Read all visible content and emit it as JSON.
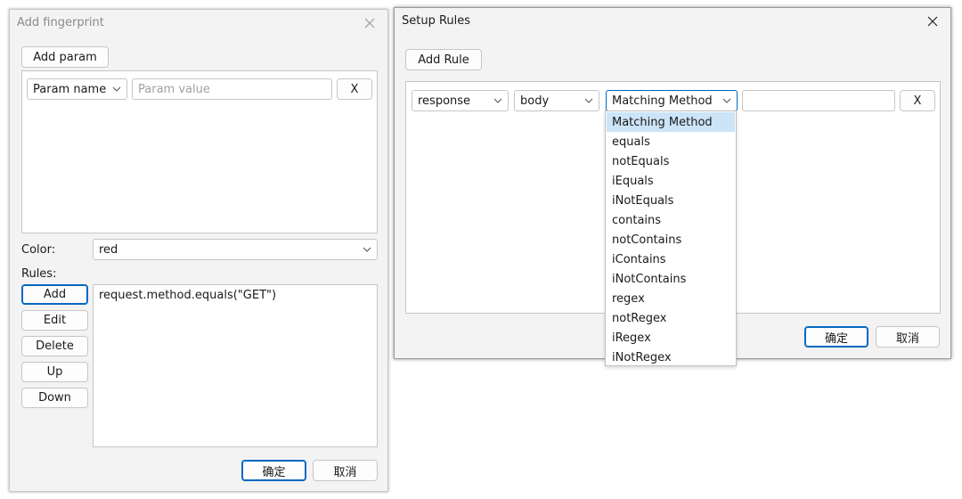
{
  "left_window": {
    "title": "Add fingerprint",
    "add_param_label": "Add param",
    "param_row": {
      "param_name": "Param name",
      "param_value_placeholder": "Param value",
      "remove_label": "X"
    },
    "color_label": "Color:",
    "color_value": "red",
    "rules_label": "Rules:",
    "rule_buttons": [
      "Add",
      "Edit",
      "Delete",
      "Up",
      "Down"
    ],
    "rules": [
      "request.method.equals(\"GET\")"
    ],
    "ok_label": "确定",
    "cancel_label": "取消"
  },
  "right_window": {
    "title": "Setup Rules",
    "add_rule_label": "Add Rule",
    "rule_row": {
      "source": "response",
      "part": "body",
      "method": "Matching Method",
      "value": "",
      "remove_label": "X"
    },
    "ok_label": "确定",
    "cancel_label": "取消"
  },
  "method_dropdown": {
    "selected": "Matching Method",
    "options": [
      "Matching Method",
      "equals",
      "notEquals",
      "iEquals",
      "iNotEquals",
      "contains",
      "notContains",
      "iContains",
      "iNotContains",
      "regex",
      "notRegex",
      "iRegex",
      "iNotRegex"
    ]
  },
  "colors": {
    "accent": "#0067c0",
    "selection": "#cce4f7",
    "window_bg": "#f3f3f3"
  }
}
